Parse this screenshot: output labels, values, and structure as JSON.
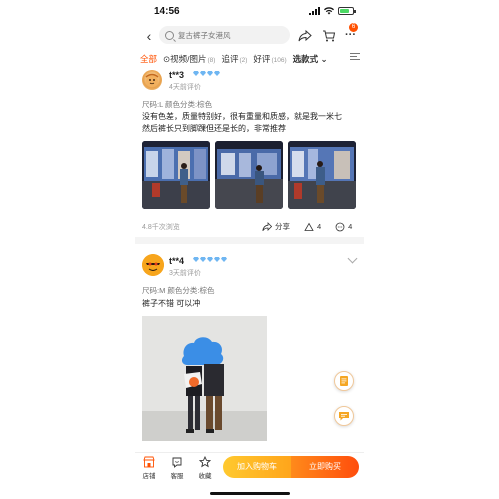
{
  "status_bar": {
    "time": "14:56"
  },
  "header": {
    "search_placeholder": "复古裤子女港风",
    "cart_badge": "6"
  },
  "tabs": [
    {
      "label": "全部",
      "count": ""
    },
    {
      "label": "⊙视频/图片",
      "count": "(8)"
    },
    {
      "label": "追评",
      "count": "(2)"
    },
    {
      "label": "好评",
      "count": "(106)"
    },
    {
      "label": "选款式",
      "count": "⌄"
    }
  ],
  "reviews": [
    {
      "user": "t**3",
      "date": "4天前评价",
      "spec": "尺码:L 颜色分类:棕色",
      "text_line1": "没有色差，质量特别好，很有重量和质感，就是我一米七",
      "text_line2": "然后裤长只到脚踝但还是长的，非常推荐",
      "views": "4.8千次浏览",
      "share_label": "分享",
      "like_count": "4",
      "comment_count": "4"
    },
    {
      "user": "t**4",
      "date": "3天前评价",
      "spec": "尺码:M 颜色分类:棕色",
      "text": "裤子不错 可以冲"
    }
  ],
  "bottom_bar": {
    "store": "店铺",
    "service": "客服",
    "favorite": "收藏",
    "add_to_cart": "加入购物车",
    "buy_now": "立即购买"
  },
  "colors": {
    "accent": "#ff5000",
    "diamond": "#6fb6f2"
  }
}
